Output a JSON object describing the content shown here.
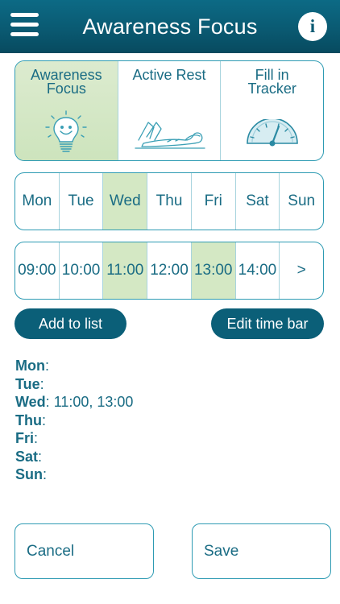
{
  "header": {
    "title": "Awareness Focus",
    "menu_icon": "hamburger-menu-icon",
    "info_icon": "info-icon",
    "info_glyph": "i"
  },
  "cards": [
    {
      "label": "Awareness Focus",
      "icon": "lightbulb-face-icon",
      "active": true
    },
    {
      "label": "Active Rest",
      "icon": "reclining-person-icon",
      "active": false
    },
    {
      "label": "Fill in Tracker",
      "icon": "gauge-icon",
      "active": false
    }
  ],
  "days": [
    {
      "label": "Mon",
      "selected": false
    },
    {
      "label": "Tue",
      "selected": false
    },
    {
      "label": "Wed",
      "selected": true
    },
    {
      "label": "Thu",
      "selected": false
    },
    {
      "label": "Fri",
      "selected": false
    },
    {
      "label": "Sat",
      "selected": false
    },
    {
      "label": "Sun",
      "selected": false
    }
  ],
  "times": [
    {
      "label": "09:00",
      "selected": false
    },
    {
      "label": "10:00",
      "selected": false
    },
    {
      "label": "11:00",
      "selected": true
    },
    {
      "label": "12:00",
      "selected": false
    },
    {
      "label": "13:00",
      "selected": true
    },
    {
      "label": "14:00",
      "selected": false
    }
  ],
  "times_next_label": ">",
  "buttons": {
    "add_to_list": "Add to list",
    "edit_time_bar": "Edit time bar",
    "cancel": "Cancel",
    "save": "Save"
  },
  "schedule": [
    {
      "day": "Mon",
      "times": ""
    },
    {
      "day": "Tue",
      "times": ""
    },
    {
      "day": "Wed",
      "times": " 11:00, 13:00"
    },
    {
      "day": "Thu",
      "times": ""
    },
    {
      "day": "Fri",
      "times": ""
    },
    {
      "day": "Sat",
      "times": ""
    },
    {
      "day": "Sun",
      "times": ""
    }
  ],
  "colors": {
    "header": "#0a5a72",
    "accent": "#1a6c84",
    "border": "#2e9bb3",
    "selected": "#d4e8c4",
    "pill": "#0b5f78"
  }
}
